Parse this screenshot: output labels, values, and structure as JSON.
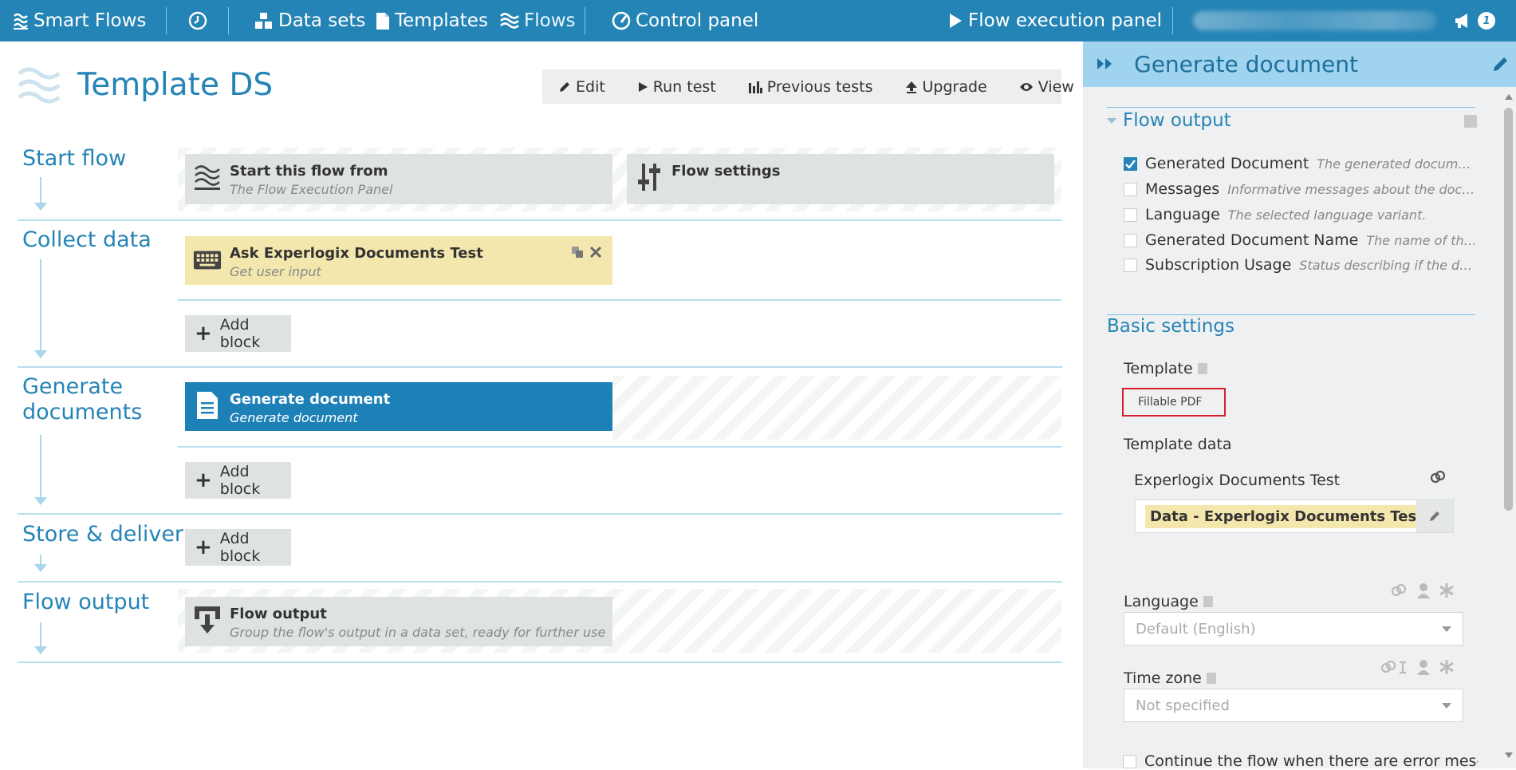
{
  "topbar": {
    "brand": "Smart Flows",
    "nav": [
      "Data sets",
      "Templates",
      "Flows"
    ],
    "control_panel": "Control panel",
    "flow_execution_panel": "Flow execution panel",
    "notification_count": "1",
    "icons": {
      "history": "clock-icon",
      "datasets": "datasets-icon",
      "templates": "document-icon",
      "flows": "waves-icon",
      "control": "gauge-icon",
      "play": "play-icon",
      "announce": "megaphone-icon"
    }
  },
  "page": {
    "title": "Template DS",
    "toolbar": [
      "Edit",
      "Run test",
      "Previous tests",
      "Upgrade",
      "View"
    ]
  },
  "lanes": {
    "start": {
      "title": "Start flow",
      "block1": {
        "title": "Start this flow from",
        "subtitle": "The Flow Execution Panel"
      },
      "block2": {
        "title": "Flow settings"
      }
    },
    "collect": {
      "title": "Collect data",
      "block": {
        "title": "Ask Experlogix Documents Test",
        "subtitle": "Get user input"
      },
      "add": "Add block"
    },
    "generate": {
      "title1": "Generate",
      "title2": "documents",
      "block": {
        "title": "Generate document",
        "subtitle": "Generate document"
      },
      "add": "Add block"
    },
    "store": {
      "title": "Store & deliver",
      "add": "Add block"
    },
    "output": {
      "title": "Flow output",
      "block": {
        "title": "Flow output",
        "subtitle": "Group the flow's output in a data set, ready for further use"
      }
    }
  },
  "panel": {
    "title": "Generate document",
    "flow_output_title": "Flow output",
    "outputs": [
      {
        "name": "Generated Document",
        "desc": "The generated document i...",
        "checked": true
      },
      {
        "name": "Messages",
        "desc": "Informative messages about the docum...",
        "checked": false
      },
      {
        "name": "Language",
        "desc": "The selected language variant.",
        "checked": false
      },
      {
        "name": "Generated Document Name",
        "desc": "The name of the do...",
        "checked": false
      },
      {
        "name": "Subscription Usage",
        "desc": "Status describing if the docu...",
        "checked": false
      }
    ],
    "basic_settings_title": "Basic settings",
    "template_label": "Template",
    "template_value": "Fillable PDF",
    "template_data_label": "Template data",
    "template_data_source": "Experlogix Documents Test",
    "template_data_tag": "Data - Experlogix Documents Test",
    "language_label": "Language",
    "language_value": "Default (English)",
    "timezone_label": "Time zone",
    "timezone_value": "Not specified",
    "continue_label": "Continue the flow when there are error mes-"
  },
  "colors": {
    "primary": "#2584b6",
    "panel_header": "#9fd3ee",
    "block_yellow": "#f4e7ad",
    "block_blue": "#1d80b7",
    "highlight": "#d61f2c"
  }
}
